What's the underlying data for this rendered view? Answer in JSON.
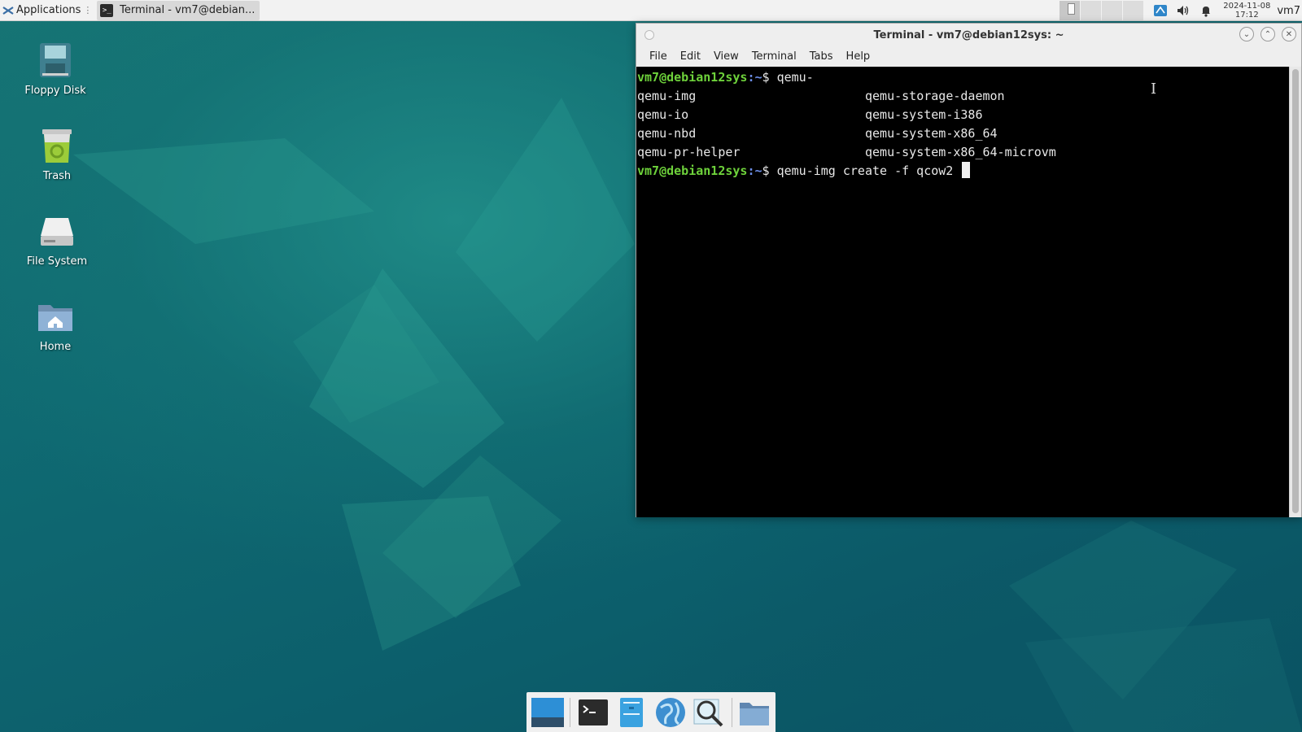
{
  "top_panel": {
    "apps_label": "Applications",
    "task_title": "Terminal - vm7@debian...",
    "clock_date": "2024-11-08",
    "clock_time": "17:12",
    "user": "vm7"
  },
  "desktop": {
    "icons": [
      {
        "label": "Floppy Disk",
        "icon": "floppy-disk-icon"
      },
      {
        "label": "Trash",
        "icon": "trash-icon"
      },
      {
        "label": "File System",
        "icon": "drive-icon"
      },
      {
        "label": "Home",
        "icon": "home-folder-icon"
      }
    ]
  },
  "terminal": {
    "title": "Terminal - vm7@debian12sys: ~",
    "menu": [
      "File",
      "Edit",
      "View",
      "Terminal",
      "Tabs",
      "Help"
    ],
    "prompt_user": "vm7@debian12sys",
    "prompt_path": ":~",
    "prompt_symbol": "$",
    "first_command": "qemu-",
    "completions": [
      [
        "qemu-img",
        "qemu-storage-daemon"
      ],
      [
        "qemu-io",
        "qemu-system-i386"
      ],
      [
        "qemu-nbd",
        "qemu-system-x86_64"
      ],
      [
        "qemu-pr-helper",
        "qemu-system-x86_64-microvm"
      ]
    ],
    "current_command": "qemu-img create -f qcow2"
  },
  "dock": {
    "items": [
      "show-desktop-icon",
      "terminal-icon",
      "file-manager-icon",
      "web-browser-icon",
      "app-finder-icon",
      "folder-icon"
    ]
  },
  "colors": {
    "prompt_user": "#6ed23b",
    "prompt_path": "#6c8ee8",
    "terminal_bg": "#000000",
    "desktop_bg": "#0e5a67"
  }
}
